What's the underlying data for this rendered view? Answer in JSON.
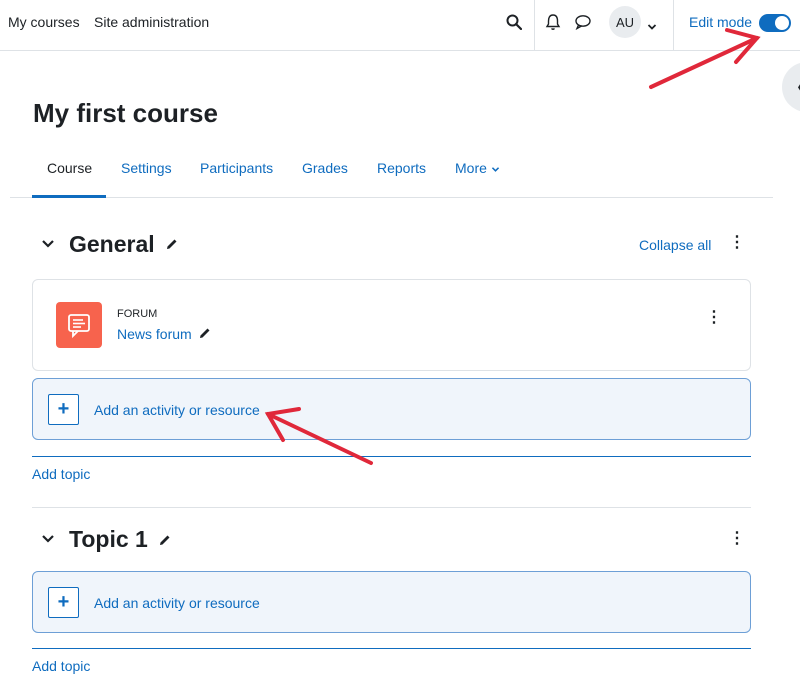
{
  "navbar": {
    "links": [
      "My courses",
      "Site administration"
    ],
    "avatar_initials": "AU",
    "edit_mode_label": "Edit mode",
    "edit_mode_on": true
  },
  "course": {
    "title": "My first course",
    "tabs": [
      "Course",
      "Settings",
      "Participants",
      "Grades",
      "Reports",
      "More"
    ],
    "active_tab": "Course"
  },
  "sections": [
    {
      "title": "General",
      "collapse_all_label": "Collapse all",
      "activity": {
        "type_label": "FORUM",
        "name": "News forum"
      },
      "add_activity_label": "Add an activity or resource",
      "add_topic_label": "Add topic"
    },
    {
      "title": "Topic 1",
      "add_activity_label": "Add an activity or resource",
      "add_topic_label": "Add topic"
    }
  ],
  "colors": {
    "accent": "#0f6cbf",
    "forum_icon_bg": "#f7634d",
    "annotation_arrow": "#e0283a"
  }
}
